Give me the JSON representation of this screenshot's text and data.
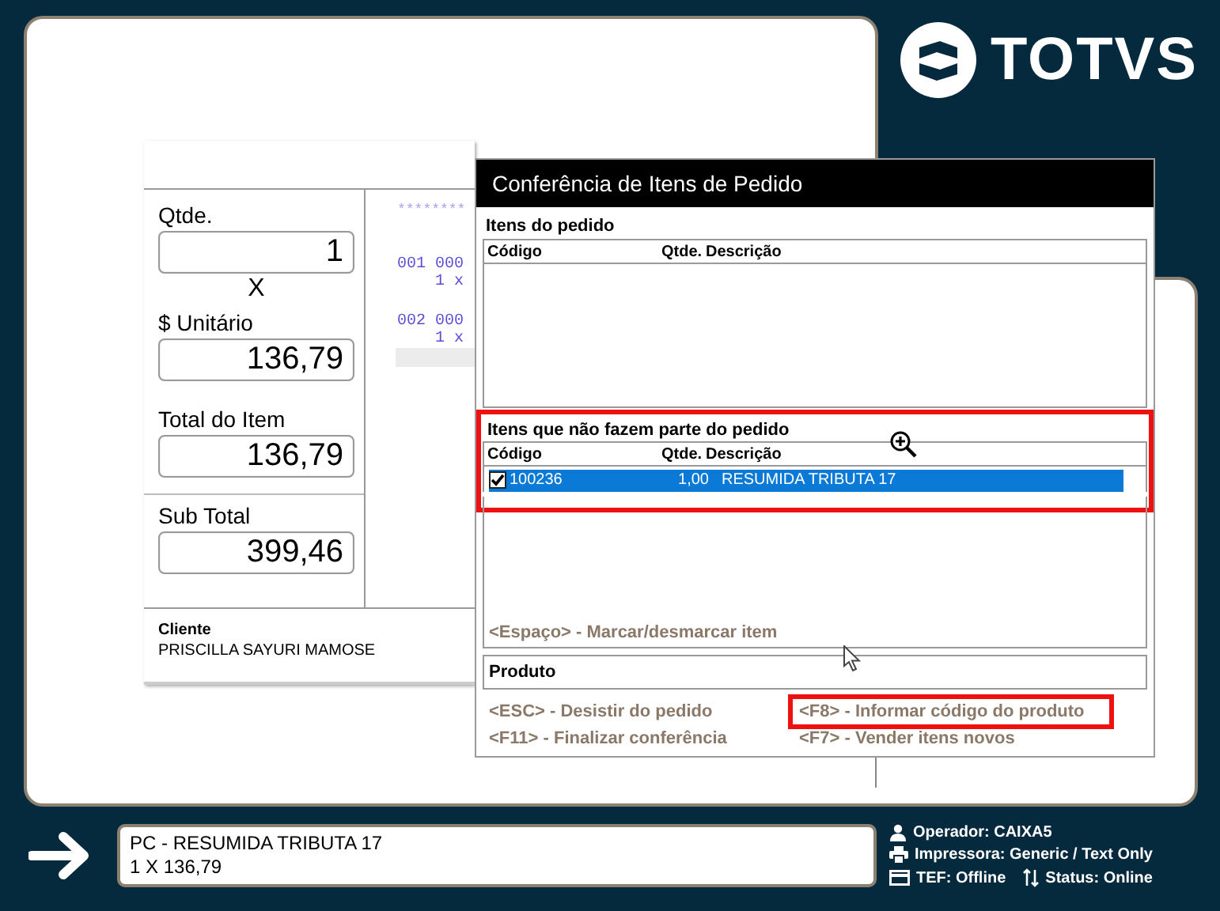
{
  "logo": {
    "text": "TOTVS"
  },
  "entry": {
    "fields": [
      {
        "label": "Qtde.",
        "value": "1"
      },
      {
        "label": "$ Unitário",
        "value": "136,79"
      },
      {
        "label": "Total do Item",
        "value": "136,79"
      },
      {
        "label": "Sub Total",
        "value": "399,46"
      }
    ],
    "operator_sign": "X",
    "customer": {
      "label": "Cliente",
      "name": "PRISCILLA SAYURI MAMOSE"
    }
  },
  "receipt": {
    "separator": "********",
    "items": [
      {
        "code": "001 000",
        "qty": "1 x"
      },
      {
        "code": "002 000",
        "qty": "1 x"
      }
    ]
  },
  "dialog": {
    "title": "Conferência de Itens de Pedido",
    "order_items": {
      "title": "Itens do pedido",
      "columns": [
        "Código",
        "Qtde.",
        "Descrição"
      ]
    },
    "extra_items": {
      "title": "Itens que não fazem parte do pedido",
      "highlighted": true,
      "columns": [
        "Código",
        "Qtde.",
        "Descrição"
      ],
      "rows": [
        {
          "code": "100236",
          "qty": "1,00",
          "description": "RESUMIDA TRIBUTA 17",
          "checked": true,
          "selected": true
        }
      ],
      "hint": "<Espaço> - Marcar/desmarcar item"
    },
    "product": {
      "label": "Produto"
    },
    "shortcuts": [
      {
        "text": "<ESC> - Desistir do pedido",
        "highlighted": false
      },
      {
        "text": "<F8> - Informar código do produto",
        "highlighted": true
      },
      {
        "text": "<F11> - Finalizar conferência",
        "highlighted": false
      },
      {
        "text": "<F7> - Vender itens novos",
        "highlighted": false
      }
    ]
  },
  "message": {
    "lines": [
      "PC - RESUMIDA TRIBUTA 17",
      "1 X 136,79"
    ]
  },
  "status_rows": [
    {
      "items": [
        {
          "kind": "operator",
          "text": "Operador: CAIXA5"
        }
      ]
    },
    {
      "items": [
        {
          "kind": "printer",
          "text": "Impressora: Generic / Text Only"
        }
      ]
    },
    {
      "items": [
        {
          "kind": "tef",
          "text": "TEF: Offline"
        },
        {
          "kind": "status",
          "text": "Status:  Online"
        }
      ]
    }
  ]
}
